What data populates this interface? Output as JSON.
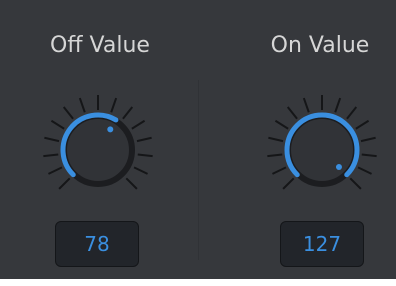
{
  "off": {
    "label": "Off Value",
    "value": "78",
    "knob_level": 0.614
  },
  "on": {
    "label": "On Value",
    "value": "127",
    "knob_level": 1.0
  },
  "colors": {
    "panel": "#36383c",
    "label": "#d6d6d6",
    "accent": "#3a8fe0",
    "value_box": "#22252a",
    "tick": "#151618"
  },
  "icons": {
    "knob": "rotary-knob-icon"
  }
}
